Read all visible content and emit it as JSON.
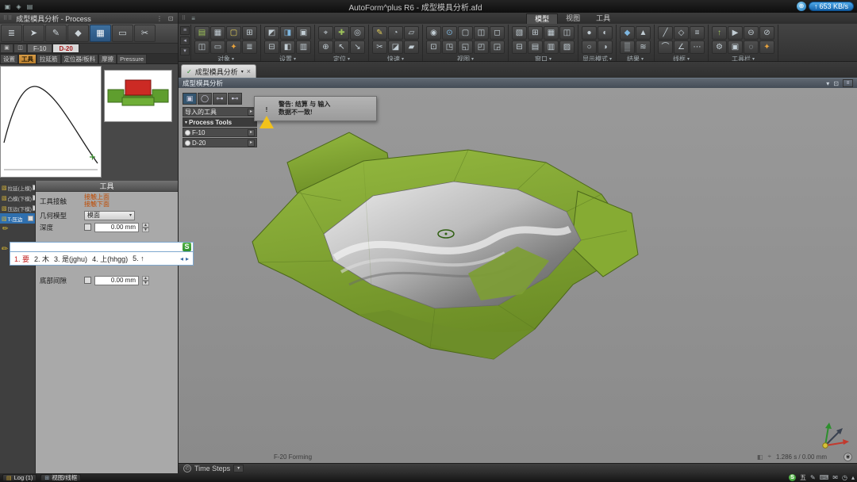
{
  "titlebar": {
    "title": "AutoForm^plus R6 - 成型模具分析.afd",
    "network_speed": "653 KB/s"
  },
  "menubar": {
    "tabs": [
      {
        "label": "模型"
      },
      {
        "label": "视图"
      },
      {
        "label": "工具"
      }
    ]
  },
  "ribbon": {
    "groups": [
      {
        "label": "对象"
      },
      {
        "label": "设置"
      },
      {
        "label": "定位"
      },
      {
        "label": "快速"
      },
      {
        "label": "视图"
      },
      {
        "label": "窗口"
      },
      {
        "label": "显示模式"
      },
      {
        "label": "结果"
      },
      {
        "label": "线框"
      },
      {
        "label": "工具栏"
      }
    ]
  },
  "left_panel": {
    "header": "成型模具分析 - Process",
    "tool_tabs": {
      "f10": "F-10",
      "d20": "D-20"
    },
    "mode_tabs": [
      {
        "label": "设置"
      },
      {
        "label": "工具"
      },
      {
        "label": "拉延筋"
      },
      {
        "label": "定位器/板料"
      },
      {
        "label": "摩擦"
      },
      {
        "label": "Pressure"
      }
    ],
    "tool_list": [
      {
        "label": "拉延(上模)"
      },
      {
        "label": "凸模(下模)"
      },
      {
        "label": "压边(下模)"
      },
      {
        "label": "T-压边"
      }
    ],
    "tool_section": {
      "title": "工具",
      "contact_label": "工具接触",
      "contact_top": "接触上面",
      "contact_bottom": "接触下面",
      "geometry_label": "几何模型",
      "geometry_value": "模面",
      "depth_label": "深度",
      "depth_value": "0.00 mm",
      "gap_label": "底部间隙",
      "gap_value": "0.00 mm"
    }
  },
  "ime": {
    "logo": "S",
    "candidates": [
      "1. 要",
      "2. 木",
      "3. 是(jghu)",
      "4. 上(hhgg)",
      "5. ↑"
    ]
  },
  "viewport": {
    "tab_label": "成型模具分析",
    "header_title": "成型模具分析",
    "warning": {
      "line1": "警告: 结算 与 输入",
      "line2": "数据不一致!"
    },
    "tree": {
      "imported_label": "导入的工具",
      "group_label": "Process Tools",
      "items": [
        {
          "label": "F-10"
        },
        {
          "label": "D-20"
        }
      ]
    },
    "status_left": "F-20 Forming",
    "status_right": "1.286 s / 0.00 mm"
  },
  "timebar": {
    "label": "Time Steps"
  },
  "taskbar": {
    "log_label": "Log (1)",
    "view_label": "视图/线框",
    "ime_mode": "五"
  },
  "icons": {
    "check": "✓",
    "close": "×",
    "chevron_down": "▾",
    "chevron_right": "▸",
    "chevron_left": "◂",
    "warning_mark": "!"
  }
}
